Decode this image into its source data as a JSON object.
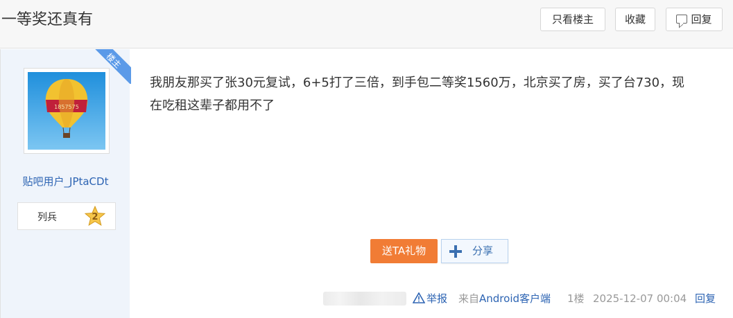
{
  "header": {
    "title": "一等奖还真有",
    "only_author_label": "只看楼主",
    "favorite_label": "收藏",
    "reply_label": "回复"
  },
  "author": {
    "badge": "楼主",
    "avatar_text": "1857575",
    "username": "贴吧用户_JPtaCDt",
    "level_name": "列兵",
    "level_number": "2"
  },
  "post": {
    "content": "我朋友那买了张30元复试，6+5打了三倍，到手包二等奖1560万，北京买了房，买了台730，现在吃租这辈子都用不了",
    "gift_label": "送TA礼物",
    "share_label": "分享"
  },
  "footer": {
    "report_label": "举报",
    "source_prefix": "来自",
    "source_link": "Android客户端",
    "floor": "1楼",
    "timestamp": "2025-12-07 00:04",
    "reply_label": "回复"
  },
  "icons": {
    "reply": "comment-icon",
    "share": "plus-icon",
    "report": "warning-icon",
    "level": "star-icon"
  },
  "colors": {
    "link": "#2d64b3",
    "gift_button": "#f17c35",
    "badge": "#5b9ae8",
    "sidebar": "#eff4fb"
  }
}
